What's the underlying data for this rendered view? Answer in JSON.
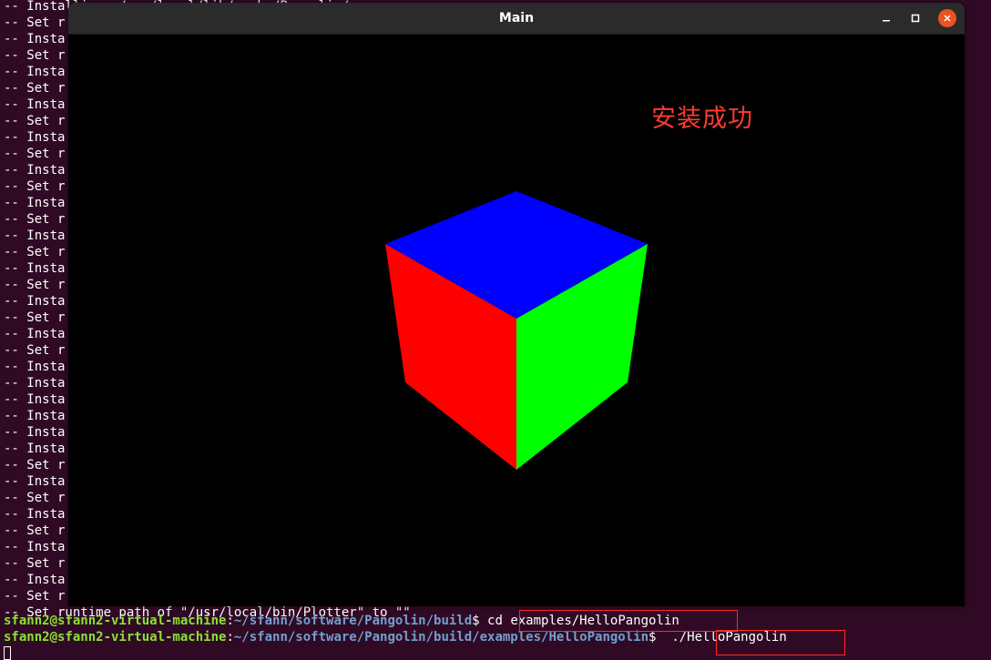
{
  "terminal": {
    "background_color": "#300a24",
    "background_lines": [
      "-- Installing: /usr/local/lib/cmake/Pangolin/...",
      "-- Set r",
      "-- Insta",
      "-- Set r",
      "-- Insta",
      "-- Set r",
      "-- Insta",
      "-- Set r",
      "-- Insta",
      "-- Set r",
      "-- Insta",
      "-- Set r",
      "-- Insta",
      "-- Set r",
      "-- Insta",
      "-- Set r",
      "-- Insta",
      "-- Set r",
      "-- Insta",
      "-- Set r",
      "-- Insta",
      "-- Set r",
      "-- Insta",
      "-- Insta",
      "-- Insta",
      "-- Insta",
      "-- Insta",
      "-- Insta",
      "-- Set r",
      "-- Insta",
      "-- Set r",
      "-- Insta",
      "-- Set r",
      "-- Insta",
      "-- Set r",
      "-- Insta",
      "-- Set r",
      "-- Set runtime path of \"/usr/local/bin/Plotter\" to \"\""
    ],
    "prompt1": {
      "user": "sfann2@sfann2-virtual-machine",
      "sep": ":",
      "path": "~/sfann/software/Pangolin/build",
      "dollar": "$ ",
      "command": "cd examples/HelloPangolin"
    },
    "prompt2": {
      "user": "sfann2@sfann2-virtual-machine",
      "sep": ":",
      "path": "~/sfann/software/Pangolin/build/examples/HelloPangolin",
      "dollar": "$  ",
      "command": "./HelloPangolin"
    },
    "colors": {
      "user": "#8ae234",
      "path": "#729fcf",
      "highlight_box": "#ff2a2a"
    }
  },
  "window": {
    "title": "Main",
    "controls": {
      "minimize_icon": "minimize-icon",
      "maximize_icon": "maximize-icon",
      "close_icon": "close-icon"
    },
    "close_button_color": "#e95420",
    "overlay_text": "安装成功",
    "overlay_text_color": "#ff3b30",
    "cube": {
      "top_face_color": "#0000ff",
      "left_face_color": "#ff0000",
      "right_face_color": "#00ff00"
    }
  }
}
